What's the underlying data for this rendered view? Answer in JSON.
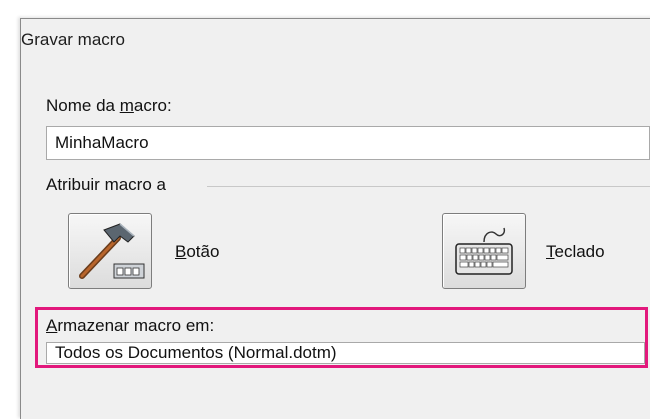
{
  "dialog": {
    "title": "Gravar macro",
    "macro_name": {
      "label_prefix": "Nome da ",
      "label_accel": "m",
      "label_suffix": "acro:",
      "value": "MinhaMacro"
    },
    "assign": {
      "label": "Atribuir macro a",
      "button": {
        "label_accel": "B",
        "label_rest": "otão",
        "icon": "hammer-icon"
      },
      "keyboard": {
        "label_accel": "T",
        "label_rest": "eclado",
        "icon": "keyboard-icon"
      }
    },
    "store": {
      "label_accel": "A",
      "label_rest": "rmazenar macro em:",
      "value": "Todos os Documentos (Normal.dotm)"
    }
  },
  "colors": {
    "highlight": "#e2187c",
    "dialog_bg": "#f0f0f0"
  }
}
